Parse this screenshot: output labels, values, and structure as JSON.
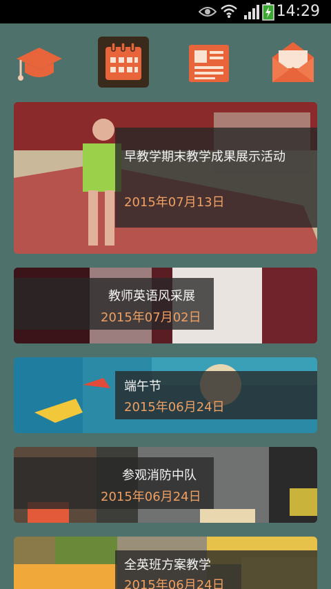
{
  "status_bar": {
    "time": "14:29",
    "icons": [
      "eye-icon",
      "wifi-icon",
      "signal-icon",
      "battery-charging-icon"
    ]
  },
  "tabs": [
    {
      "icon": "graduation-cap-icon",
      "active": false
    },
    {
      "icon": "calendar-icon",
      "active": true
    },
    {
      "icon": "newspaper-icon",
      "active": false
    },
    {
      "icon": "open-envelope-icon",
      "active": false
    }
  ],
  "colors": {
    "background": "#4f716b",
    "accent_orange": "#e8643a",
    "date_orange": "#f0a062",
    "active_tab": "#3a2a1c"
  },
  "events": [
    {
      "title": "早教学期末教学成果展示活动",
      "date": "2015年07月13日"
    },
    {
      "title": "教师英语风采展",
      "date": "2015年07月02日"
    },
    {
      "title": "端午节",
      "date": "2015年06月24日"
    },
    {
      "title": "参观消防中队",
      "date": "2015年06月24日"
    },
    {
      "title": "全英班方案教学",
      "date": "2015年06月24日"
    }
  ]
}
